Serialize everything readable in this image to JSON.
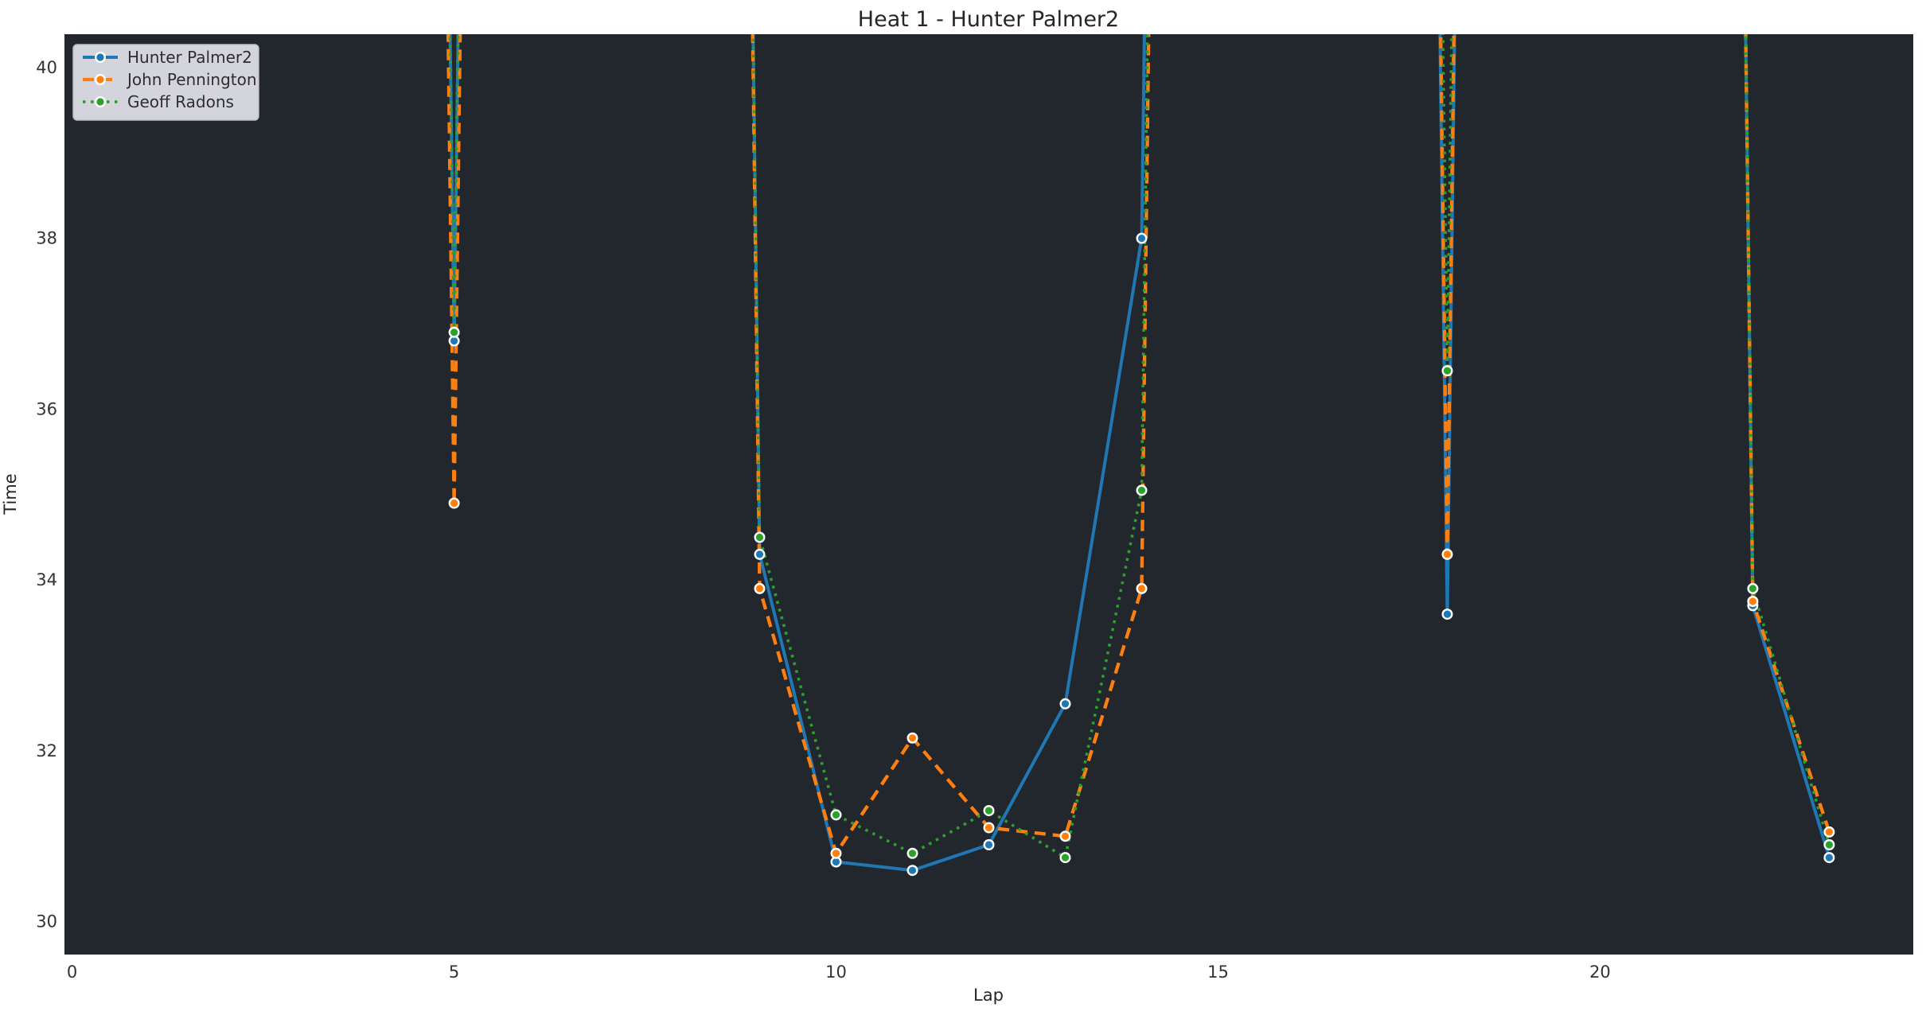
{
  "chart_data": {
    "type": "line",
    "title": "Heat 1 - Hunter Palmer2",
    "xlabel": "Lap",
    "ylabel": "Time",
    "xlim": [
      -0.1,
      24.1
    ],
    "ylim": [
      29.615,
      40.39
    ],
    "xticks": [
      0,
      5,
      10,
      15,
      20
    ],
    "yticks": [
      30,
      32,
      34,
      36,
      38,
      40
    ],
    "grid": false,
    "legend_position": "upper left",
    "plot_bg": "#22272e",
    "fig_bg": "#ffffff",
    "legend_bg": "#d4d5dc",
    "legend_border": "#bcbdc6",
    "offscale_render_value": 105,
    "series": [
      {
        "name": "Hunter Palmer2",
        "color": "#1f77b4",
        "linestyle": "solid",
        "points": [
          [
            5,
            36.8
          ],
          [
            9,
            34.3
          ],
          [
            10,
            30.7
          ],
          [
            11,
            30.6
          ],
          [
            12,
            30.9
          ],
          [
            13,
            32.55
          ],
          [
            14,
            38.0
          ],
          [
            18,
            33.6
          ],
          [
            22,
            33.7
          ],
          [
            23,
            30.75
          ]
        ],
        "offscale_laps": [
          1,
          2,
          3,
          4,
          6,
          7,
          8,
          15,
          16,
          17,
          19,
          20,
          21
        ]
      },
      {
        "name": "John Pennington",
        "color": "#ff7f0e",
        "linestyle": "dashed",
        "points": [
          [
            5,
            34.9
          ],
          [
            9,
            33.9
          ],
          [
            10,
            30.8
          ],
          [
            11,
            32.15
          ],
          [
            12,
            31.1
          ],
          [
            13,
            31.0
          ],
          [
            14,
            33.9
          ],
          [
            18,
            34.3
          ],
          [
            22,
            33.75
          ],
          [
            23,
            31.05
          ]
        ],
        "offscale_laps": [
          1,
          2,
          3,
          4,
          6,
          7,
          8,
          15,
          16,
          17,
          19,
          20,
          21
        ]
      },
      {
        "name": "Geoff Radons",
        "color": "#2ca02c",
        "linestyle": "dotted",
        "points": [
          [
            5,
            36.9
          ],
          [
            9,
            34.5
          ],
          [
            10,
            31.25
          ],
          [
            11,
            30.8
          ],
          [
            12,
            31.3
          ],
          [
            13,
            30.75
          ],
          [
            14,
            35.05
          ],
          [
            18,
            36.45
          ],
          [
            22,
            33.9
          ],
          [
            23,
            30.9
          ]
        ],
        "offscale_laps": [
          1,
          2,
          3,
          4,
          6,
          7,
          8,
          15,
          16,
          17,
          19,
          20,
          21
        ]
      }
    ]
  }
}
